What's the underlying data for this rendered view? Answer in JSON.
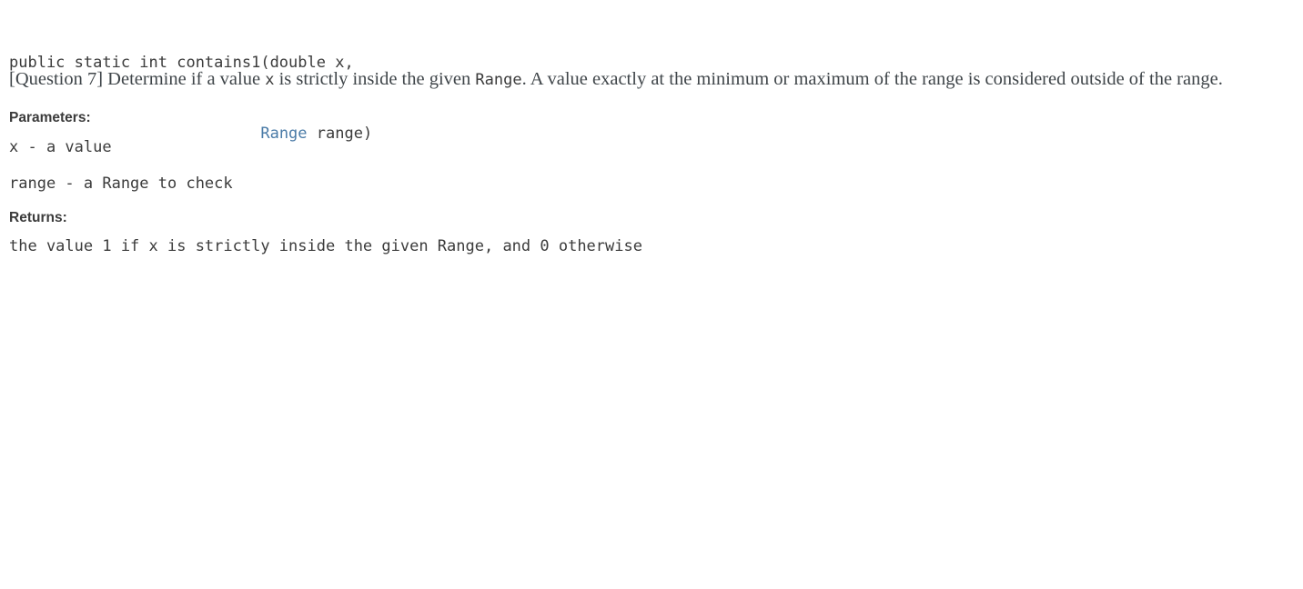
{
  "signature": {
    "line1": "public static int contains1(double x,",
    "line2_indent": "                           ",
    "line2_type": "Range",
    "line2_rest": " range)",
    "type_link_color": "#4a7ba7"
  },
  "description": {
    "prefix": "[Question 7] Determine if a value ",
    "code1": "x",
    "mid1": " is strictly inside the given ",
    "code2": "Range",
    "mid2": ". A value exactly at the minimum or maximum of the range is considered outside of the range."
  },
  "parameters": {
    "heading": "Parameters:",
    "items": [
      "x - a value",
      "range - a Range to check"
    ]
  },
  "returns": {
    "heading": "Returns:",
    "items": [
      "the value 1 if x is strictly inside the given Range, and 0 otherwise"
    ]
  },
  "colors": {
    "background": "#ffffff",
    "code_text": "#3b3b3b",
    "body_text": "#3f4549",
    "link": "#4a7ba7"
  }
}
